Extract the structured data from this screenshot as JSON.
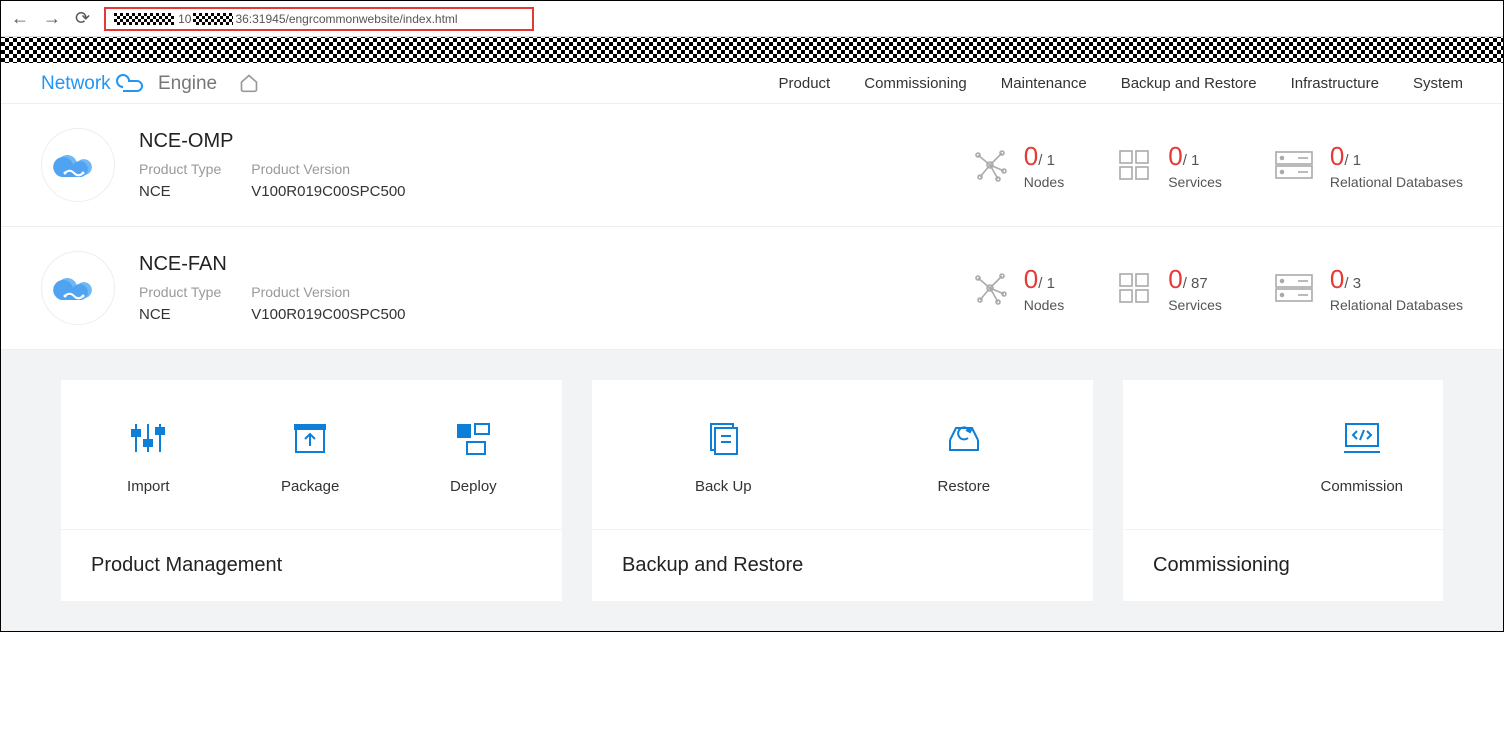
{
  "url": "36:31945/engrcommonwebsite/index.html",
  "url_prefix": "10",
  "logo": {
    "brand1": "Network",
    "cloud": "Cloud",
    "brand2": " Engine"
  },
  "nav": [
    "Product",
    "Commissioning",
    "Maintenance",
    "Backup and Restore",
    "Infrastructure",
    "System"
  ],
  "stat_labels": {
    "nodes": "Nodes",
    "services": "Services",
    "rdb": "Relational Databases"
  },
  "meta_labels": {
    "type": "Product Type",
    "version": "Product Version"
  },
  "products": [
    {
      "name": "NCE-OMP",
      "type": "NCE",
      "version": "V100R019C00SPC500",
      "nodes_ok": "0",
      "nodes_total": "1",
      "svc_ok": "0",
      "svc_total": "1",
      "rdb_ok": "0",
      "rdb_total": "1"
    },
    {
      "name": "NCE-FAN",
      "type": "NCE",
      "version": "V100R019C00SPC500",
      "nodes_ok": "0",
      "nodes_total": "1",
      "svc_ok": "0",
      "svc_total": "87",
      "rdb_ok": "0",
      "rdb_total": "3"
    }
  ],
  "cards": {
    "pm": {
      "title": "Product Management",
      "actions": {
        "import": "Import",
        "package": "Package",
        "deploy": "Deploy"
      }
    },
    "br": {
      "title": "Backup and Restore",
      "actions": {
        "backup": "Back Up",
        "restore": "Restore"
      }
    },
    "cm": {
      "title": "Commissioning",
      "actions": {
        "commission": "Commission"
      }
    }
  }
}
